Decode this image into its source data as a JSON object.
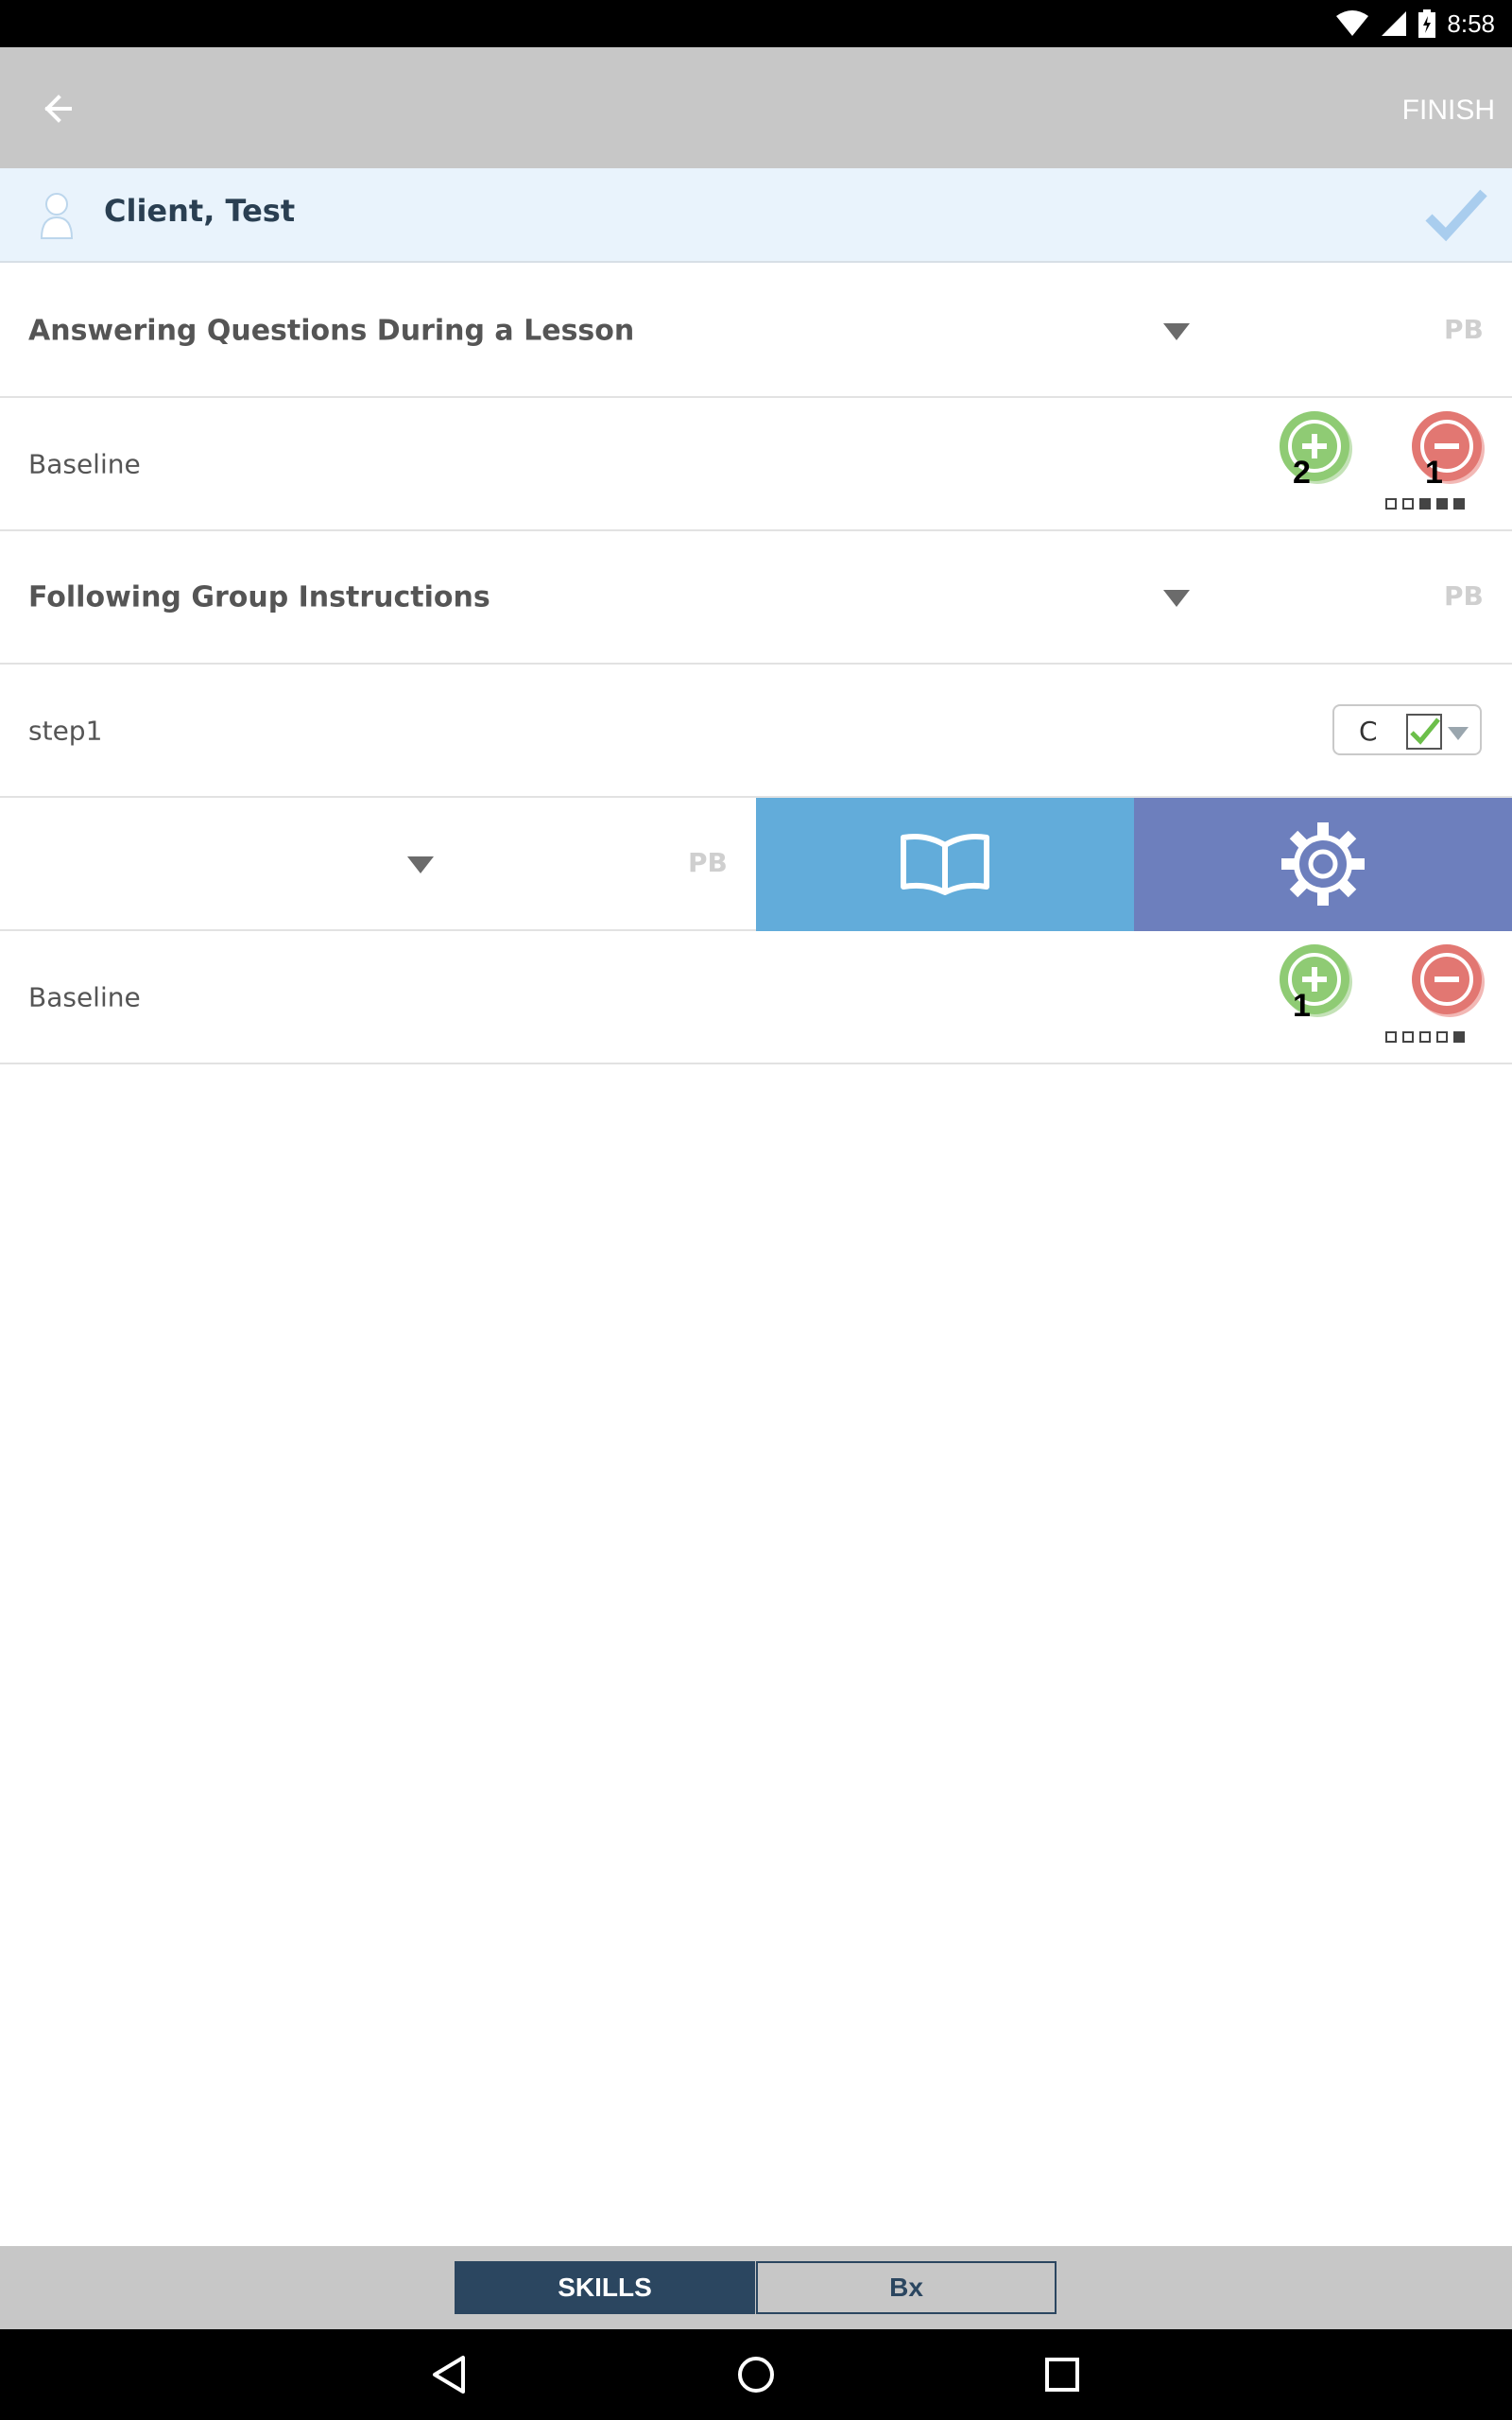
{
  "status_bar": {
    "time": "8:58"
  },
  "app_bar": {
    "finish_label": "FINISH"
  },
  "client": {
    "name": "Client, Test"
  },
  "programs": [
    {
      "title": "Answering Questions During a Lesson",
      "badge": "PB",
      "target": {
        "label": "Baseline",
        "plus_count": "2",
        "minus_count": "1",
        "trial_dots": [
          false,
          false,
          true,
          true,
          true
        ]
      }
    },
    {
      "title": "Following Group Instructions",
      "badge": "PB",
      "target": {
        "label": "step1",
        "score": "C"
      }
    },
    {
      "title": "",
      "badge": "PB",
      "swipe_actions": [
        "book-icon",
        "gear-icon"
      ],
      "target": {
        "label": "Baseline",
        "plus_count": "1",
        "minus_count": "",
        "trial_dots": [
          false,
          false,
          false,
          false,
          true
        ]
      }
    }
  ],
  "bottom_tabs": {
    "skills_label": "SKILLS",
    "bx_label": "Bx"
  },
  "colors": {
    "header_gray": "#c7c7c7",
    "client_bar": "#e9f3fc",
    "plus_green": "#8fcb74",
    "minus_red": "#e27772",
    "book_blue": "#62acda",
    "gear_purple": "#6d7fbd",
    "tab_navy": "#2b4660"
  }
}
